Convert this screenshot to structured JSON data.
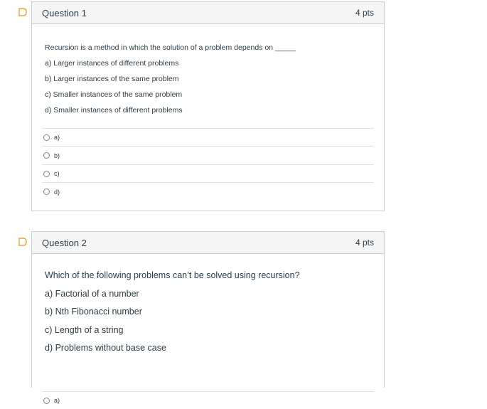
{
  "questions": [
    {
      "title": "Question 1",
      "points": "4 pts",
      "prompt": "Recursion is a method in which the solution of a problem depends on _____",
      "choices": [
        "a) Larger instances of different problems",
        "b) Larger instances of the same problem",
        "c) Smaller instances of the same problem",
        "d) Smaller instances of different problems"
      ],
      "answers": [
        "a)",
        "b)",
        "c)",
        "d)"
      ]
    },
    {
      "title": "Question 2",
      "points": "4 pts",
      "prompt": "Which of the following problems can’t be solved using recursion?",
      "choices": [
        "a) Factorial of a number",
        "b) Nth Fibonacci number",
        "c) Length of a string",
        "d) Problems without base case"
      ],
      "answers": [
        "a)"
      ]
    }
  ],
  "icons": {
    "flag": "flag-question-icon",
    "radio": "radio-button"
  },
  "colors": {
    "header_bg": "#f5f5f5",
    "border": "#c7cdd1",
    "text": "#2d3b45",
    "flag": "#e8a63a"
  }
}
